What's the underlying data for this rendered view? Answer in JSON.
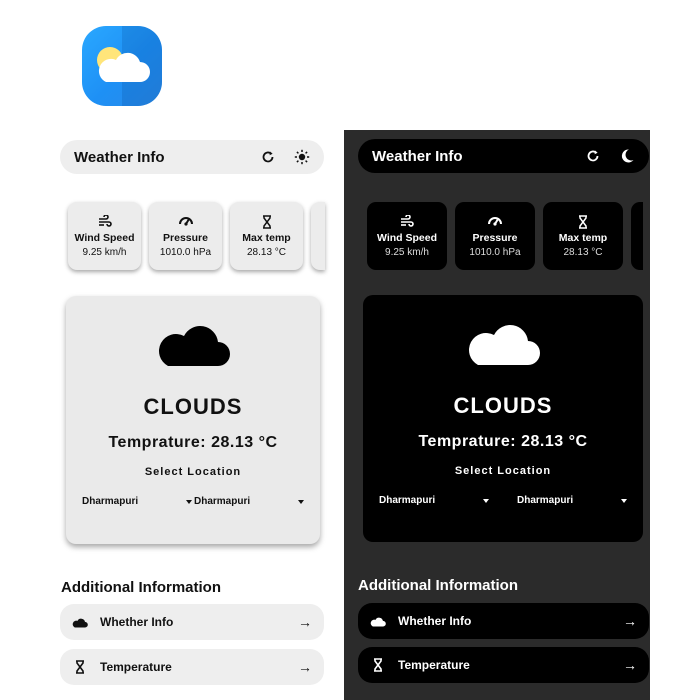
{
  "app_icon": {
    "name": "weather-app-icon"
  },
  "light": {
    "appbar": {
      "title": "Weather Info",
      "refresh_icon": "refresh-icon",
      "theme_icon": "sun-icon"
    },
    "stats": [
      {
        "icon": "wind-icon",
        "label": "Wind Speed",
        "value": "9.25 km/h"
      },
      {
        "icon": "pressure-icon",
        "label": "Pressure",
        "value": "1010.0 hPa"
      },
      {
        "icon": "hourglass-icon",
        "label": "Max temp",
        "value": "28.13 °C"
      }
    ],
    "card": {
      "icon": "cloud-icon",
      "condition": "CLOUDS",
      "temperature": "Temprature: 28.13 °C",
      "select_location": "Select Location",
      "dropdown_1": "Dharmapuri",
      "dropdown_2": "Dharmapuri"
    },
    "additional_title": "Additional Information",
    "rows": [
      {
        "icon": "cloud-icon",
        "label": "Whether Info"
      },
      {
        "icon": "hourglass-icon",
        "label": "Temperature"
      }
    ],
    "arrow": "→"
  },
  "dark": {
    "appbar": {
      "title": "Weather Info",
      "refresh_icon": "refresh-icon",
      "theme_icon": "moon-icon"
    },
    "stats": [
      {
        "icon": "wind-icon",
        "label": "Wind Speed",
        "value": "9.25 km/h"
      },
      {
        "icon": "pressure-icon",
        "label": "Pressure",
        "value": "1010.0 hPa"
      },
      {
        "icon": "hourglass-icon",
        "label": "Max temp",
        "value": "28.13 °C"
      }
    ],
    "card": {
      "icon": "cloud-icon",
      "condition": "CLOUDS",
      "temperature": "Temprature: 28.13 °C",
      "select_location": "Select Location",
      "dropdown_1": "Dharmapuri",
      "dropdown_2": "Dharmapuri"
    },
    "additional_title": "Additional Information",
    "rows": [
      {
        "icon": "cloud-icon",
        "label": "Whether Info"
      },
      {
        "icon": "hourglass-icon",
        "label": "Temperature"
      }
    ],
    "arrow": "→"
  },
  "colors": {
    "accent_blue": "#1e90f5",
    "dark_bg": "#2b2b2b",
    "light_card": "#eaeaea"
  }
}
